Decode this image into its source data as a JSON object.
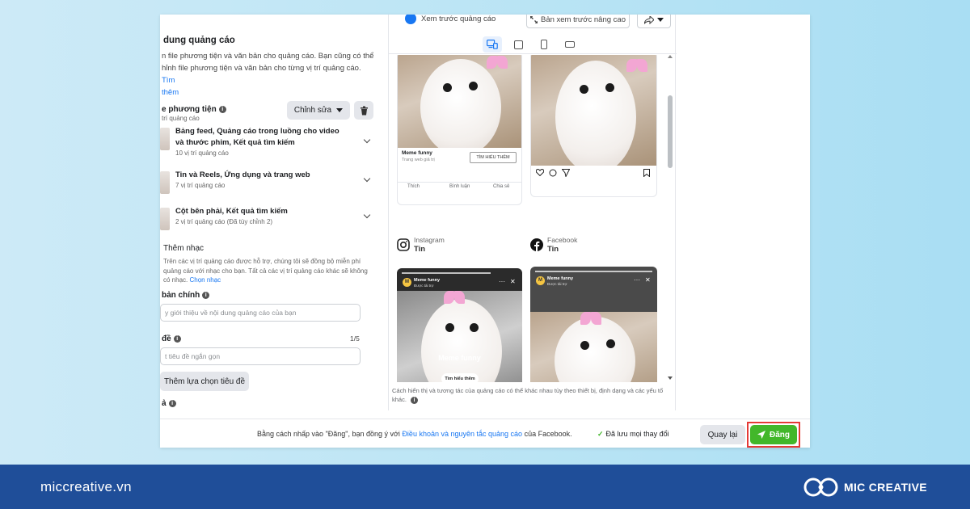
{
  "editor": {
    "section_title": "dung quảng cáo",
    "section_desc": "n file phương tiện và văn bản cho quảng cáo. Bạn cũng có thể hỉnh file phương tiện và văn bản cho từng vị trí quảng cáo.",
    "section_link_a": "Tìm",
    "section_link_b": "thêm",
    "media_label": "e phương tiện",
    "media_sub": "trí quảng cáo",
    "edit_button": "Chỉnh sửa",
    "placements": [
      {
        "title": "Bảng feed, Quảng cáo trong luồng cho video và thước phim, Kết quả tìm kiếm",
        "sub": "10 vị trí quảng cáo"
      },
      {
        "title": "Tin và Reels, Ứng dụng và trang web",
        "sub": "7 vị trí quảng cáo"
      },
      {
        "title": "Cột bên phải, Kết quả tìm kiếm",
        "sub": "2 vị trí quảng cáo (Đã tùy chỉnh 2)"
      }
    ],
    "music_title": "Thêm nhạc",
    "music_desc": "Trên các vị trí quảng cáo được hỗ trợ, chúng tôi sẽ đồng bộ miễn phí quảng cáo với nhạc cho bạn. Tất cả các vị trí quảng cáo khác sẽ không có nhạc.",
    "music_link": "Chọn nhạc",
    "primary_text_label": "bản chính",
    "primary_text_placeholder": "y giới thiệu về nội dung quảng cáo của bạn",
    "headline_label": "đề",
    "headline_counter": "1/5",
    "headline_placeholder": "t tiêu đề ngắn gọn",
    "add_headline_button": "Thêm lựa chọn tiêu đề",
    "desc_label": "ả"
  },
  "preview": {
    "toggle_label": "Xem trước quảng cáo",
    "advanced_button": "Bản xem trước nâng cao",
    "fb_feed": {
      "caption_title": "Meme funny",
      "caption_sub": "Trang web giả trị",
      "cta": "TÌM HIỂU THÊM",
      "like": "Thích",
      "comment": "Bình luận",
      "share": "Chia sẻ"
    },
    "platforms": [
      {
        "name": "Instagram",
        "type": "Tin"
      },
      {
        "name": "Facebook",
        "type": "Tin"
      }
    ],
    "story_ig": {
      "avatar": "M",
      "name": "Meme funny",
      "sub": "Được tài trợ",
      "text": "Meme funny",
      "cta": "Tìm hiểu thêm"
    },
    "story_fb": {
      "avatar": "M",
      "name": "Meme funny",
      "sub": "Được tài trợ"
    },
    "disclaimer": "Cách hiển thị và tương tác của quảng cáo có thể khác nhau tùy theo thiết bị, định dạng và các yếu tố khác."
  },
  "footer_bar": {
    "terms_prefix": "Bằng cách nhấp vào \"Đăng\", bạn đồng ý với",
    "terms_link": "Điều khoản và nguyên tắc quảng cáo",
    "terms_suffix": "của Facebook.",
    "saved": "Đã lưu mọi thay đổi",
    "back_button": "Quay lại",
    "publish_button": "Đăng"
  },
  "branding": {
    "site": "miccreative.vn",
    "name": "MIC CREATIVE"
  },
  "colors": {
    "accent": "#1877f2",
    "publish": "#42b72a",
    "highlight": "#e53935",
    "footer_bg": "#1f4e99"
  }
}
